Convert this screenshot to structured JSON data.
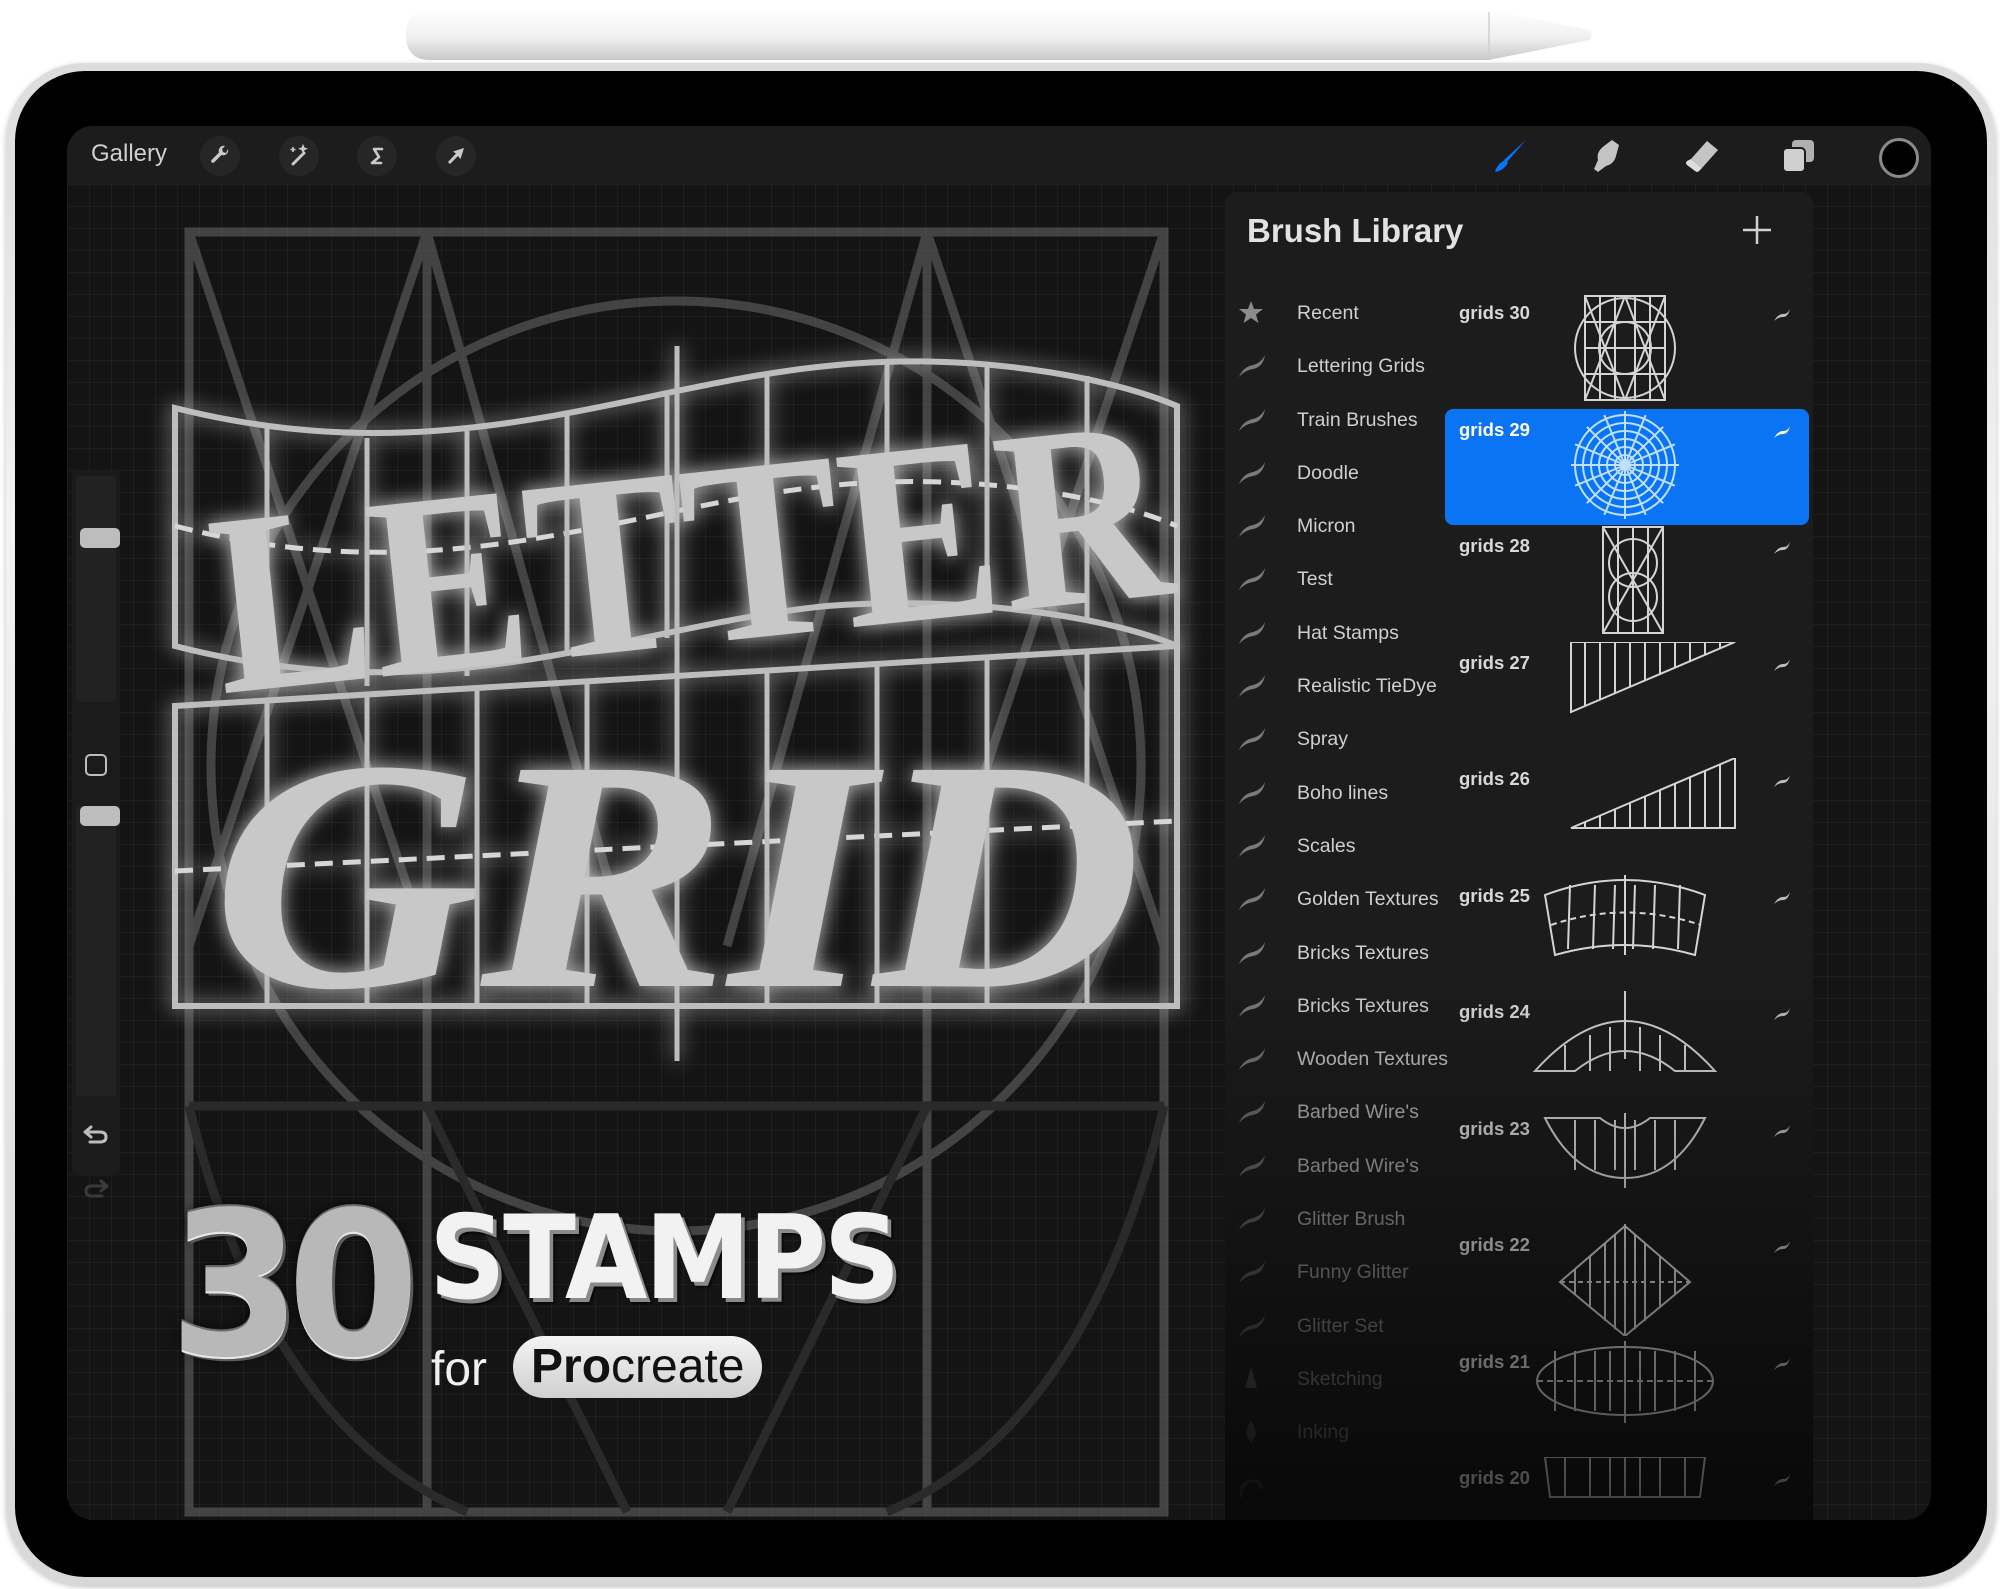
{
  "toolbar": {
    "gallery_label": "Gallery",
    "left_tools": [
      {
        "name": "actions",
        "icon": "wrench-icon"
      },
      {
        "name": "adjustments",
        "icon": "magic-wand-icon"
      },
      {
        "name": "selection",
        "icon": "selection-s-icon"
      },
      {
        "name": "transform",
        "icon": "arrow-cursor-icon"
      }
    ],
    "right_tools": [
      {
        "name": "brush",
        "icon": "brush-icon",
        "active": true
      },
      {
        "name": "smudge",
        "icon": "smudge-finger-icon"
      },
      {
        "name": "eraser",
        "icon": "eraser-icon"
      },
      {
        "name": "layers",
        "icon": "layers-icon"
      }
    ],
    "active_color": "#000000",
    "accent_color": "#0a74f5"
  },
  "sidebar": {
    "brush_size_level": 0.75,
    "opacity_level": 1.0,
    "undo_label": "undo",
    "redo_label": "redo"
  },
  "brush_library": {
    "title": "Brush Library",
    "add_label": "+",
    "categories": [
      {
        "label": "Recent",
        "icon": "star"
      },
      {
        "label": "Lettering Grids",
        "icon": "stroke"
      },
      {
        "label": "Train Brushes",
        "icon": "stroke"
      },
      {
        "label": "Doodle",
        "icon": "stroke"
      },
      {
        "label": "Micron",
        "icon": "stroke"
      },
      {
        "label": "Test",
        "icon": "stroke"
      },
      {
        "label": "Hat Stamps",
        "icon": "stroke"
      },
      {
        "label": "Realistic TieDye",
        "icon": "stroke"
      },
      {
        "label": "Spray",
        "icon": "stroke"
      },
      {
        "label": "Boho lines",
        "icon": "stroke"
      },
      {
        "label": "Scales",
        "icon": "stroke"
      },
      {
        "label": "Golden Textures",
        "icon": "stroke"
      },
      {
        "label": "Bricks Textures",
        "icon": "stroke"
      },
      {
        "label": "Bricks Textures",
        "icon": "stroke"
      },
      {
        "label": "Wooden Textures",
        "icon": "stroke"
      },
      {
        "label": "Barbed Wire's",
        "icon": "stroke"
      },
      {
        "label": "Barbed Wire's",
        "icon": "stroke"
      },
      {
        "label": "Glitter Brush",
        "icon": "stroke"
      },
      {
        "label": "Funny Glitter",
        "icon": "stroke"
      },
      {
        "label": "Glitter Set",
        "icon": "stroke"
      },
      {
        "label": "Sketching",
        "icon": "pencil-tip"
      },
      {
        "label": "Inking",
        "icon": "pen-nib"
      },
      {
        "label": "",
        "icon": "brush-curve"
      }
    ],
    "brushes": [
      {
        "name": "grids 30",
        "thumb": "square-geometric"
      },
      {
        "name": "grids 29",
        "thumb": "radial",
        "selected": true
      },
      {
        "name": "grids 28",
        "thumb": "tall-geometric"
      },
      {
        "name": "grids 27",
        "thumb": "wedge-down"
      },
      {
        "name": "grids 26",
        "thumb": "wedge-up"
      },
      {
        "name": "grids 25",
        "thumb": "arc-banner"
      },
      {
        "name": "grids 24",
        "thumb": "arch"
      },
      {
        "name": "grids 23",
        "thumb": "smile"
      },
      {
        "name": "grids 22",
        "thumb": "diamond"
      },
      {
        "name": "grids 21",
        "thumb": "ellipse"
      },
      {
        "name": "grids 20",
        "thumb": "trapezoid"
      }
    ]
  },
  "artwork": {
    "line1": "LETTER",
    "line2": "GRID"
  },
  "promo": {
    "count": "30",
    "headline": "STAMPS",
    "for_label": "for",
    "brand_bold": "Pro",
    "brand_rest": "create"
  }
}
